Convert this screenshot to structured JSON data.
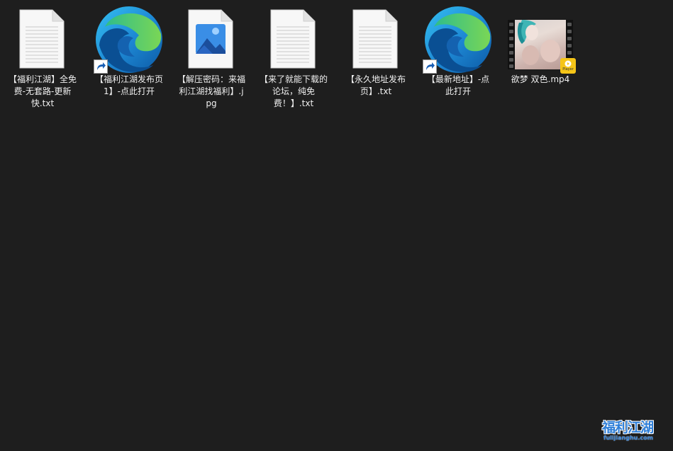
{
  "desktop": {
    "files": [
      {
        "label": "【福利江湖】全免费-无套路-更新快.txt",
        "icon": "text-document-icon"
      },
      {
        "label": "【福利江湖发布页1】-点此打开",
        "icon": "edge-shortcut-icon"
      },
      {
        "label": "【解压密码：来福利江湖找福利】.jpg",
        "icon": "image-file-icon"
      },
      {
        "label": "【来了就能下载的论坛，纯免费！】.txt",
        "icon": "text-document-icon"
      },
      {
        "label": "【永久地址发布页】.txt",
        "icon": "text-document-icon"
      },
      {
        "label": "【最新地址】-点此打开",
        "icon": "edge-shortcut-icon"
      },
      {
        "label": "欲梦 双色.mp4",
        "icon": "video-file-icon"
      }
    ]
  },
  "watermark": {
    "title": "福利江湖",
    "subtitle": "fulijianghu.com"
  },
  "player_badge_text": "Player",
  "colors": {
    "background": "#1e1e1e",
    "label_text": "#f0f0f0",
    "watermark_blue": "#2f7fd8"
  }
}
